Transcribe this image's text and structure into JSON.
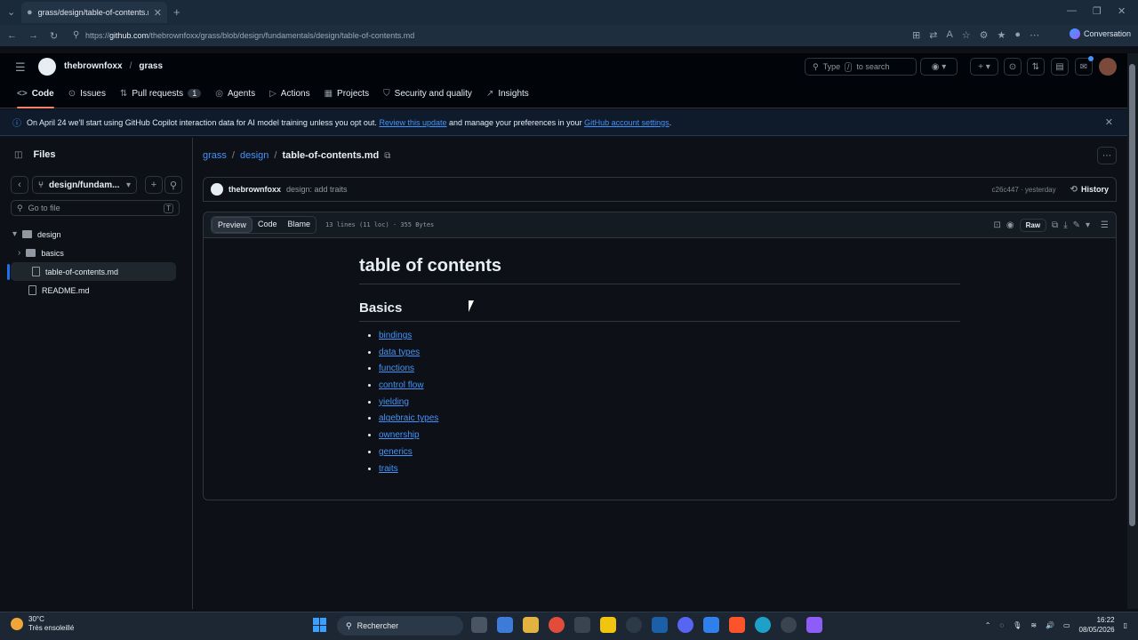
{
  "browser": {
    "tab_title": "grass/design/table-of-contents.m",
    "url_prefix": "https://",
    "url_host": "github.com",
    "url_path": "/thebrownfoxx/grass/blob/design/fundamentals/design/table-of-contents.md",
    "conversation_label": "Conversation"
  },
  "header": {
    "owner": "thebrownfoxx",
    "separator": "/",
    "repo": "grass",
    "search_prefix": "Type",
    "search_key": "/",
    "search_suffix": "to search"
  },
  "repo_nav": {
    "code": "Code",
    "issues": "Issues",
    "pull_requests": "Pull requests",
    "pull_requests_count": "1",
    "agents": "Agents",
    "actions": "Actions",
    "projects": "Projects",
    "security": "Security and quality",
    "insights": "Insights"
  },
  "banner": {
    "text_before": "On April 24 we'll start using GitHub Copilot interaction data for AI model training unless you opt out.",
    "link1": "Review this update",
    "text_middle": "and manage your preferences in your",
    "link2": "GitHub account settings",
    "text_after": "."
  },
  "sidebar": {
    "title": "Files",
    "branch": "design/fundam...",
    "goto_placeholder": "Go to file",
    "goto_key": "T",
    "tree": {
      "design": "design",
      "basics": "basics",
      "toc": "table-of-contents.md",
      "readme": "README.md"
    }
  },
  "breadcrumb": {
    "root": "grass",
    "folder": "design",
    "file": "table-of-contents.md",
    "sep": "/"
  },
  "commit": {
    "author": "thebrownfoxx",
    "message": "design: add traits",
    "meta": "c26c447 · yesterday",
    "history": "History"
  },
  "file_toolbar": {
    "preview": "Preview",
    "code": "Code",
    "blame": "Blame",
    "meta": "13 lines (11 loc) · 355 Bytes",
    "raw": "Raw"
  },
  "markdown": {
    "h1": "table of contents",
    "h2": "Basics",
    "items": [
      "bindings",
      "data types",
      "functions",
      "control flow",
      "yielding",
      "algebraic types",
      "ownership",
      "generics",
      "traits"
    ]
  },
  "taskbar": {
    "temp": "30°C",
    "weather": "Très ensoleillé",
    "search": "Rechercher",
    "time": "16:22",
    "date": "08/05/2026"
  },
  "colors": {
    "link": "#4493f8",
    "active_tab_underline": "#f78166",
    "page_bg": "#0d1117"
  }
}
